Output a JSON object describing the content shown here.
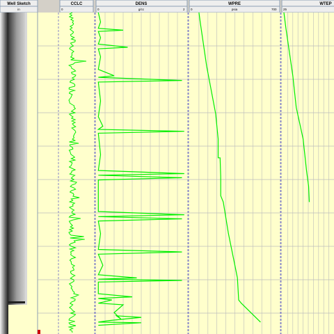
{
  "colors": {
    "track_bg": "#ffffcc",
    "curve": "#00ee00",
    "grid": "#bcbcbc",
    "header_bg": "#eeeeee",
    "header_border": "#8c9fb4",
    "divider": "#6a6ac8",
    "sketch_marker": "#cc0000"
  },
  "tracks": [
    {
      "id": "well-sketch",
      "title": "Well Sketch",
      "unit": "in",
      "left": "",
      "right": ""
    },
    {
      "id": "cclc",
      "title": "CCLC",
      "unit": "",
      "left": "0",
      "right": ""
    },
    {
      "id": "dens",
      "title": "DENS",
      "unit": "g/cc",
      "left": "0",
      "right": "2"
    },
    {
      "id": "wpre",
      "title": "WPRE",
      "unit": "psia",
      "left": "0",
      "right": "700"
    },
    {
      "id": "wtep",
      "title": "WTEP",
      "unit": "",
      "left": "25",
      "right": ""
    }
  ],
  "chart_data": {
    "type": "line",
    "depth_range": [
      0,
      100
    ],
    "grid": true,
    "series": [
      {
        "name": "DENS",
        "x_range": [
          0,
          2
        ],
        "points": [
          [
            0.05,
            0
          ],
          [
            0.1,
            3
          ],
          [
            0.05,
            5
          ],
          [
            0.6,
            5.6
          ],
          [
            0.05,
            6
          ],
          [
            0.1,
            8
          ],
          [
            0.05,
            10
          ],
          [
            0.7,
            11
          ],
          [
            0.05,
            11.5
          ],
          [
            0.1,
            14
          ],
          [
            0.05,
            18
          ],
          [
            0.4,
            20
          ],
          [
            0.05,
            20.5
          ],
          [
            1.9,
            21.5
          ],
          [
            0.05,
            22
          ],
          [
            0.1,
            28
          ],
          [
            0.05,
            33
          ],
          [
            0.15,
            36
          ],
          [
            0.05,
            37
          ],
          [
            1.95,
            37.6
          ],
          [
            0.05,
            38.2
          ],
          [
            0.1,
            45
          ],
          [
            0.05,
            50
          ],
          [
            1.95,
            51
          ],
          [
            0.05,
            51.5
          ],
          [
            1.9,
            52.3
          ],
          [
            0.05,
            53
          ],
          [
            0.05,
            63
          ],
          [
            1.95,
            64
          ],
          [
            0.05,
            64.6
          ],
          [
            1.9,
            65.3
          ],
          [
            0.05,
            66
          ],
          [
            0.1,
            70
          ],
          [
            0.05,
            75
          ],
          [
            1.9,
            75.8
          ],
          [
            0.05,
            76.5
          ],
          [
            0.15,
            80
          ],
          [
            0.05,
            83
          ],
          [
            0.9,
            84
          ],
          [
            0.05,
            84.4
          ],
          [
            1.9,
            84.8
          ],
          [
            0.05,
            85.3
          ],
          [
            0.05,
            89
          ],
          [
            0.8,
            90
          ],
          [
            0.05,
            90.5
          ],
          [
            0.35,
            91
          ],
          [
            0.05,
            92
          ],
          [
            0.6,
            92.5
          ],
          [
            0.4,
            95
          ],
          [
            0.55,
            97
          ],
          [
            0.45,
            96
          ],
          [
            1.0,
            96.5
          ],
          [
            0.3,
            97.5
          ],
          [
            0.05,
            98
          ],
          [
            1.0,
            98.2
          ],
          [
            0.05,
            99
          ]
        ]
      },
      {
        "name": "WPRE",
        "x_range": [
          0,
          700
        ],
        "points": [
          [
            70,
            0
          ],
          [
            80,
            3
          ],
          [
            130,
            17
          ],
          [
            200,
            32
          ],
          [
            220,
            40
          ],
          [
            220,
            46
          ],
          [
            235,
            46
          ],
          [
            240,
            52
          ],
          [
            240,
            58
          ],
          [
            260,
            60
          ],
          [
            300,
            70
          ],
          [
            340,
            78
          ],
          [
            370,
            84
          ],
          [
            380,
            91
          ],
          [
            400,
            92
          ],
          [
            550,
            98
          ]
        ]
      },
      {
        "name": "WTEP",
        "x_range": [
          25,
          100
        ],
        "points": [
          [
            27,
            0
          ],
          [
            30,
            5
          ],
          [
            40,
            20
          ],
          [
            45,
            30
          ],
          [
            55,
            40
          ],
          [
            60,
            50
          ],
          [
            63,
            55
          ],
          [
            64,
            60
          ]
        ]
      }
    ]
  }
}
